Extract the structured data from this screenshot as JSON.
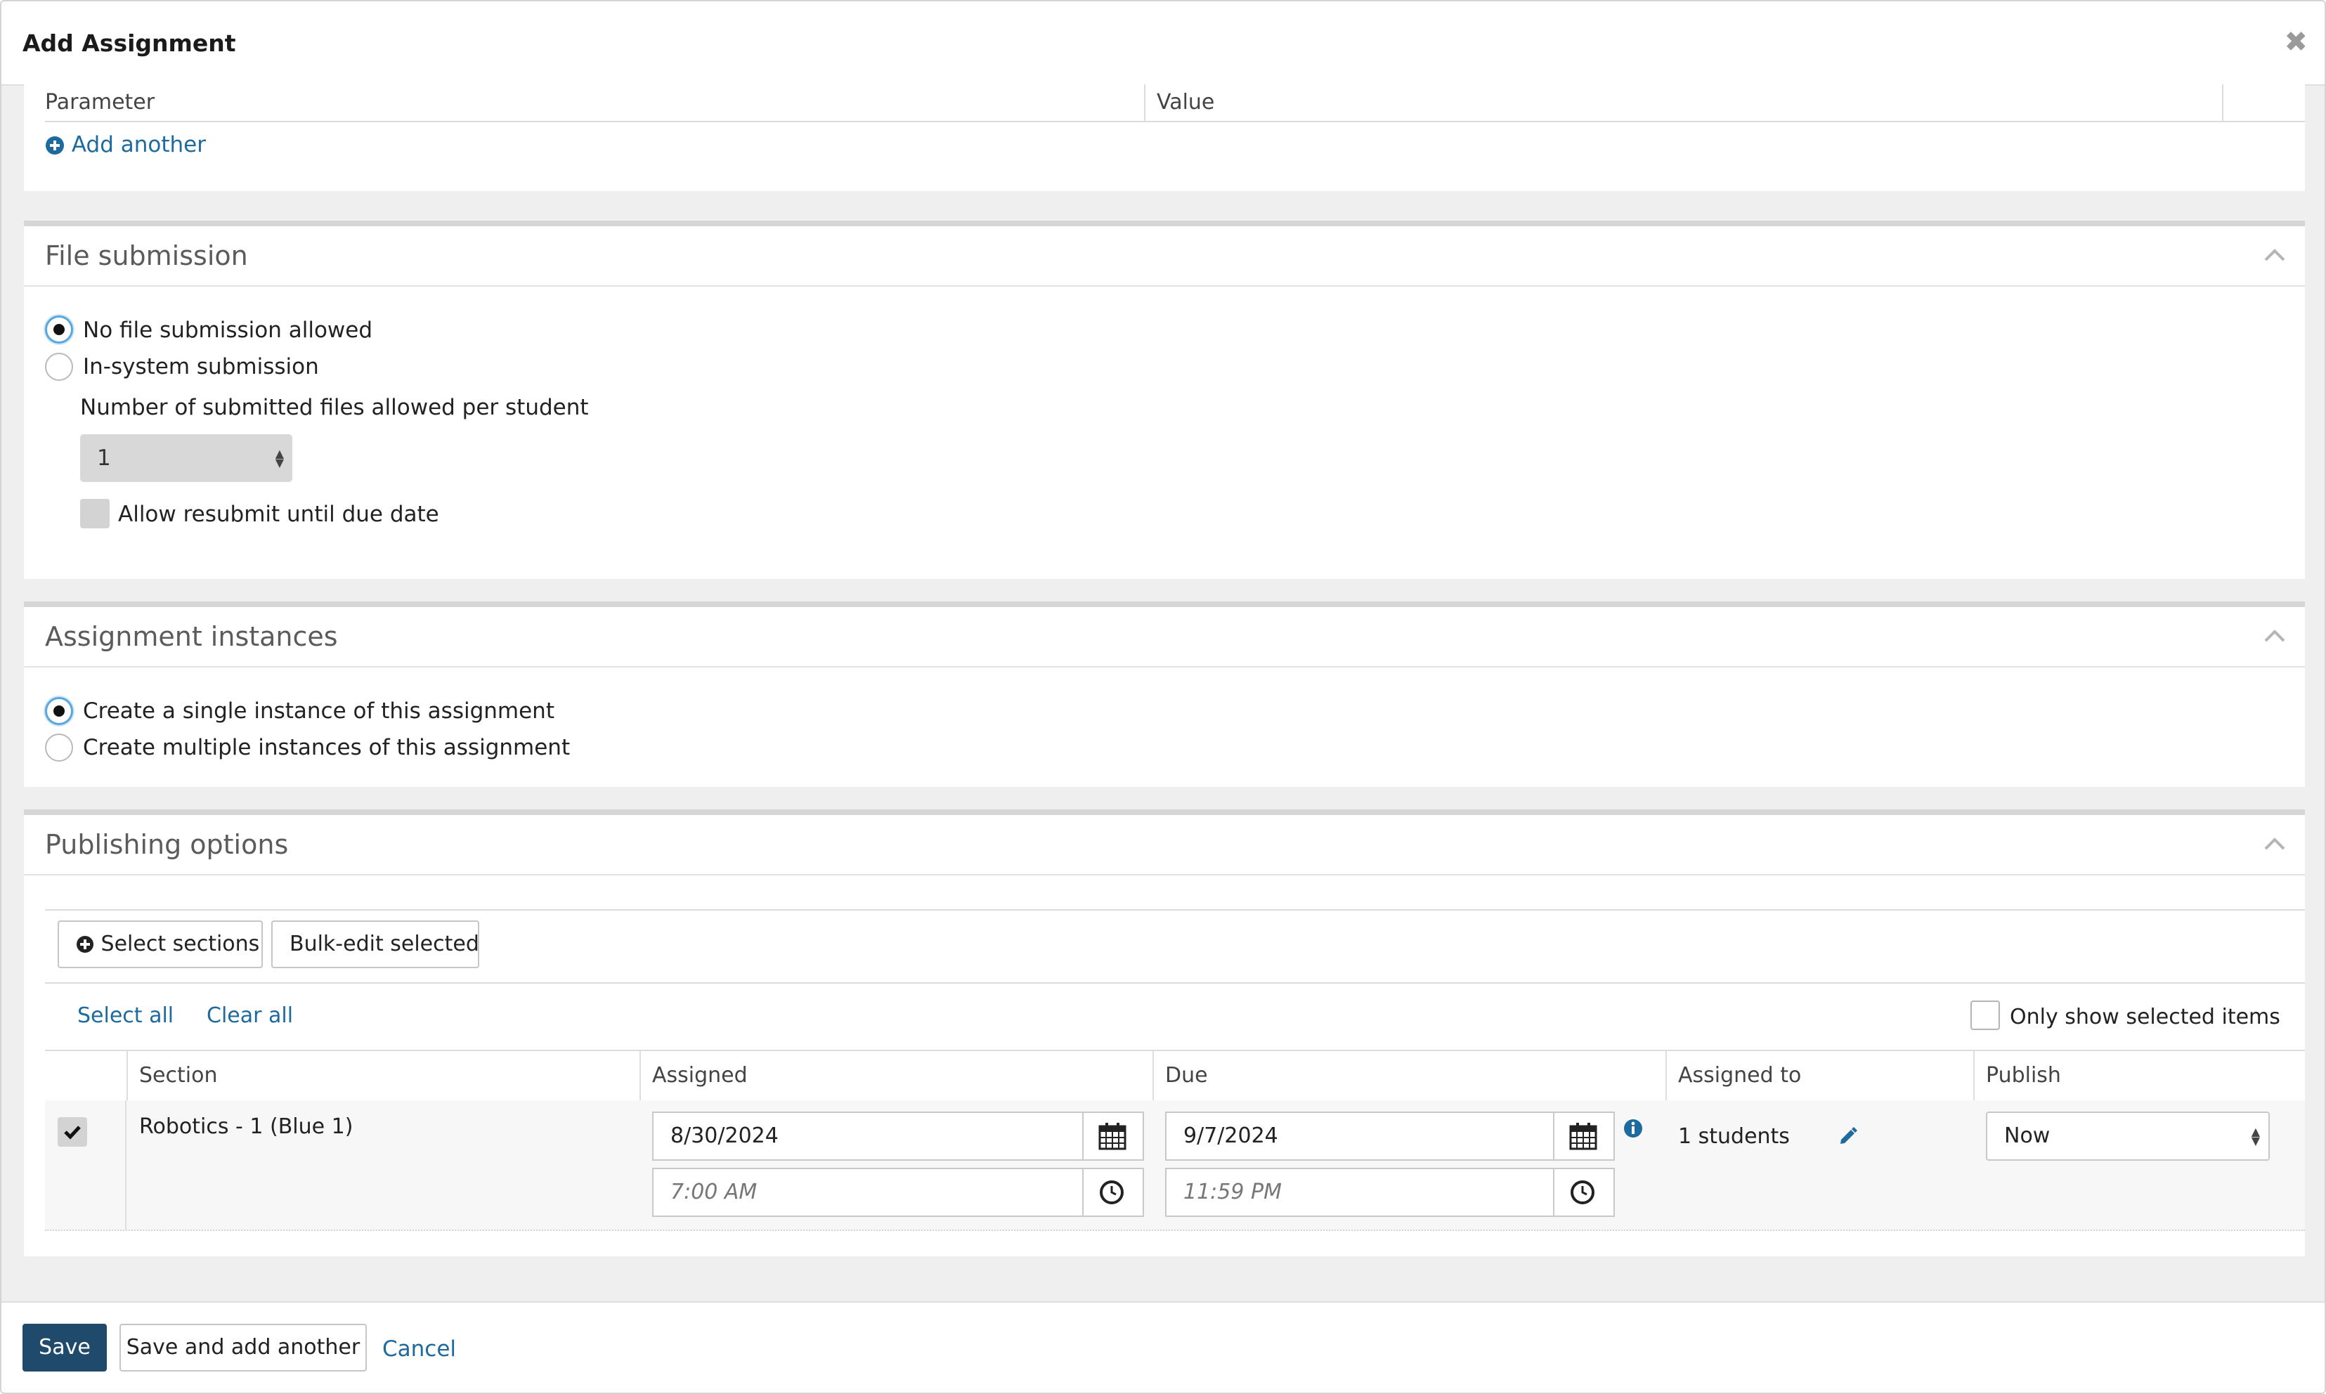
{
  "modal": {
    "title": "Add Assignment"
  },
  "parameters": {
    "col_parameter": "Parameter",
    "col_value": "Value",
    "add_another": "Add another"
  },
  "file_submission": {
    "title": "File submission",
    "option_none": "No file submission allowed",
    "option_in_system": "In-system submission",
    "files_label": "Number of submitted files allowed per student",
    "files_value": "1",
    "resubmit_label": "Allow resubmit until due date"
  },
  "instances": {
    "title": "Assignment instances",
    "option_single": "Create a single instance of this assignment",
    "option_multiple": "Create multiple instances of this assignment"
  },
  "publishing": {
    "title": "Publishing options",
    "select_sections": "Select sections",
    "bulk_edit": "Bulk-edit selected",
    "select_all": "Select all",
    "clear_all": "Clear all",
    "only_selected": "Only show selected items",
    "columns": {
      "section": "Section",
      "assigned": "Assigned",
      "due": "Due",
      "assigned_to": "Assigned to",
      "publish": "Publish"
    },
    "row": {
      "section": "Robotics - 1 (Blue 1)",
      "assigned_date": "8/30/2024",
      "assigned_time": "7:00 AM",
      "due_date": "9/7/2024",
      "due_time": "11:59 PM",
      "assigned_to": "1 students",
      "publish": "Now"
    }
  },
  "footer": {
    "save": "Save",
    "save_add": "Save and add another",
    "cancel": "Cancel"
  },
  "colors": {
    "primary": "#1f4a6b",
    "link": "#1d6a9f",
    "radio_focus": "#5aa7de"
  }
}
